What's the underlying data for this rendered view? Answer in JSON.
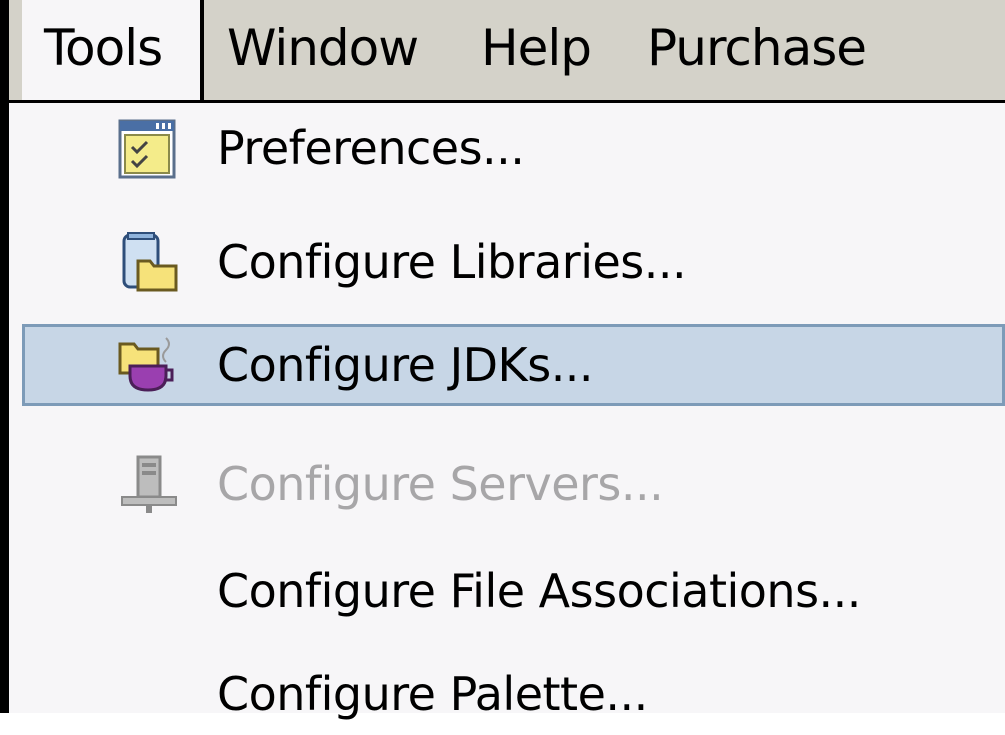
{
  "menubar": {
    "items": [
      {
        "label": "Tools",
        "mnemonic": "T"
      },
      {
        "label": "Window",
        "mnemonic": "W"
      },
      {
        "label": "Help",
        "mnemonic": "H"
      },
      {
        "label": "Purchase",
        "mnemonic": "u"
      }
    ]
  },
  "tools_menu": {
    "items": [
      {
        "label": "Preferences...",
        "icon": "preferences-icon",
        "enabled": true,
        "selected": false
      },
      {
        "label": "Configure Libraries...",
        "icon": "libraries-icon",
        "enabled": true,
        "selected": false
      },
      {
        "label": "Configure JDKs...",
        "icon": "jdk-icon",
        "enabled": true,
        "selected": true
      },
      {
        "label": "Configure Servers...",
        "icon": "servers-icon",
        "enabled": false,
        "selected": false
      },
      {
        "label": "Configure File Associations...",
        "icon": "",
        "enabled": true,
        "selected": false
      },
      {
        "label": "Configure Palette...",
        "icon": "",
        "enabled": true,
        "selected": false
      }
    ]
  },
  "colors": {
    "menubar_bg": "#d4d2c9",
    "menu_bg": "#f7f6f8",
    "selection_bg": "#c7d6e6",
    "selection_border": "#7d9bb8",
    "disabled_text": "#a7a6a8"
  }
}
